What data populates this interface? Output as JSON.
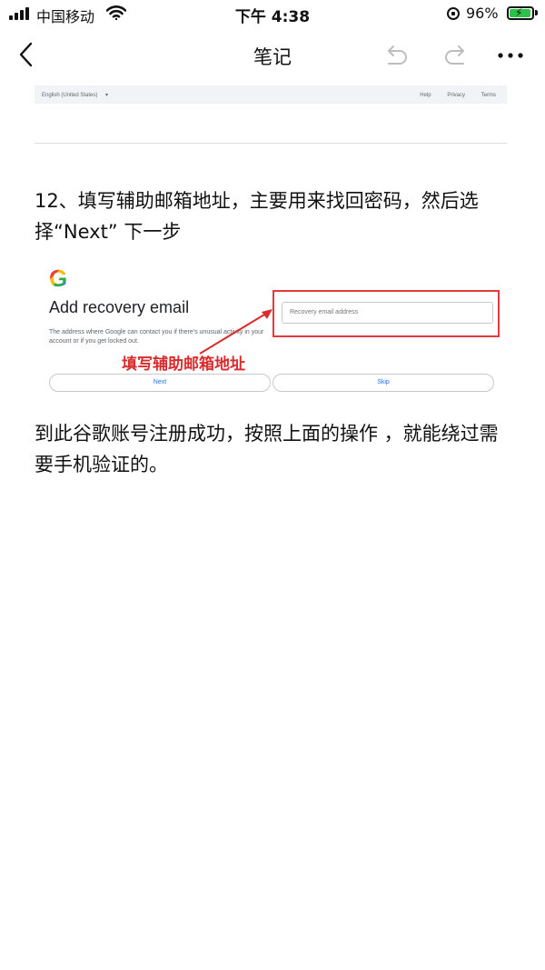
{
  "status_bar": {
    "carrier": "中国移动",
    "time": "下午 4:38",
    "battery_percent": "96%",
    "battery_level": 0.96,
    "icons": [
      "signal-icon",
      "wifi-icon",
      "orientation-lock-icon",
      "battery-icon"
    ]
  },
  "nav": {
    "title": "笔记",
    "icons": [
      "back-icon",
      "undo-icon",
      "redo-icon",
      "more-icon"
    ]
  },
  "content": {
    "footer_strip": {
      "language": "English (United States)",
      "links": [
        "Help",
        "Privacy",
        "Terms"
      ]
    },
    "paragraph1": "12、填写辅助邮箱地址，主要用来找回密码，然后选择“Next” 下一步",
    "screenshot": {
      "logo": "G",
      "heading": "Add recovery email",
      "description": "The address where Google can contact you if there's unusual activity in your account or if you get locked out.",
      "input_placeholder": "Recovery email address",
      "annotation": "填写辅助邮箱地址",
      "next_label": "Next",
      "skip_label": "Skip"
    },
    "paragraph2": "到此谷歌账号注册成功，按照上面的操作 ，就能绕过需要手机验证的。"
  },
  "colors": {
    "annotation_red": "#d92b2b",
    "google_blue": "#4285f4",
    "google_red": "#ea4335",
    "google_yellow": "#fbbc05",
    "google_green": "#34a853",
    "battery_green": "#2ec24a"
  }
}
